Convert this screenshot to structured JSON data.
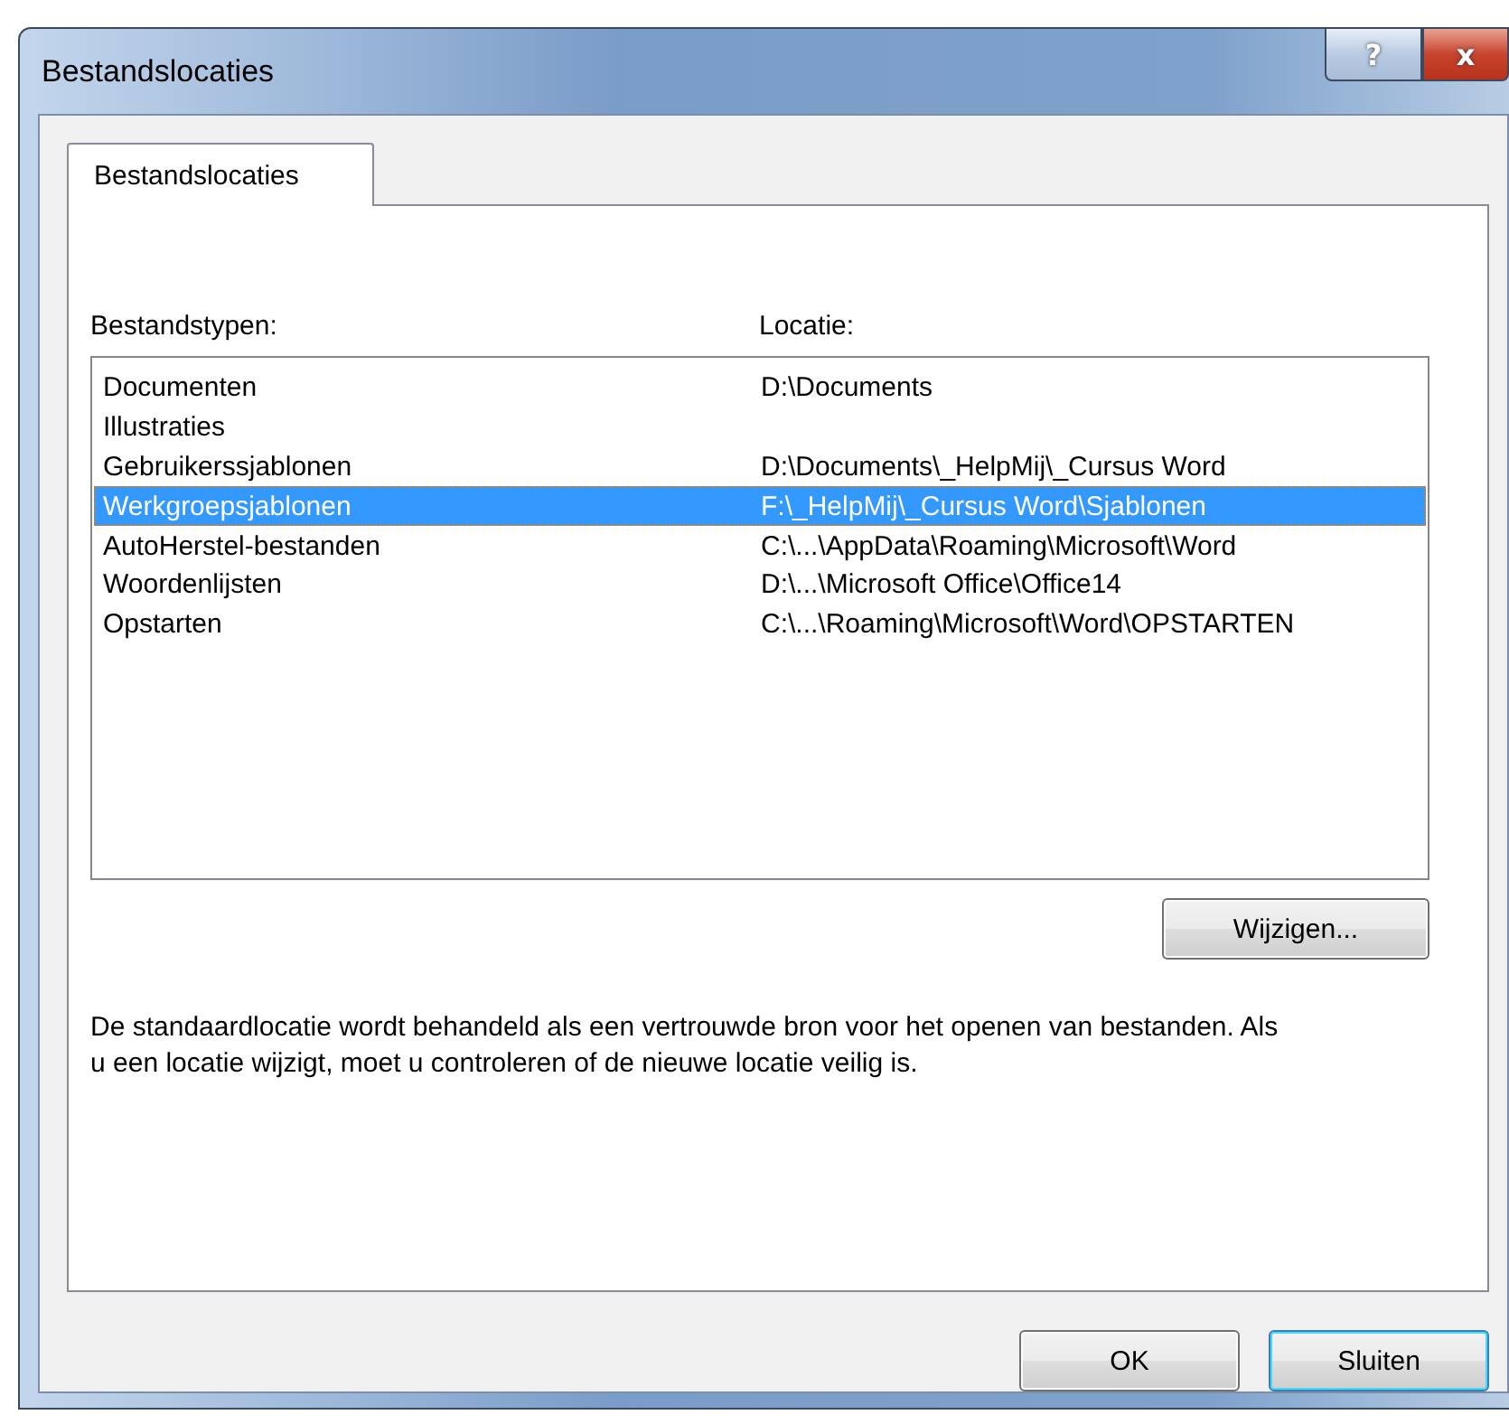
{
  "window": {
    "title": "Bestandslocaties",
    "title_buttons": [
      "?",
      "x"
    ]
  },
  "tabs": [
    {
      "label": "Bestandslocaties",
      "selected": true
    }
  ],
  "list": {
    "columns": [
      "Bestandstypen:",
      "Locatie:"
    ],
    "rows": [
      {
        "type": "Documenten",
        "location": "D:\\Documents",
        "selected": false
      },
      {
        "type": "Illustraties",
        "location": "",
        "selected": false
      },
      {
        "type": "Gebruikerssjablonen",
        "location": "D:\\Documents\\_HelpMij\\_Cursus Word",
        "selected": false
      },
      {
        "type": "Werkgroepsjablonen",
        "location": "F:\\_HelpMij\\_Cursus Word\\Sjablonen",
        "selected": true
      },
      {
        "type": "AutoHerstel-bestanden",
        "location": "C:\\...\\AppData\\Roaming\\Microsoft\\Word",
        "selected": false
      },
      {
        "type": "Woordenlijsten",
        "location": "D:\\...\\Microsoft Office\\Office14",
        "selected": false
      },
      {
        "type": "Opstarten",
        "location": "C:\\...\\Roaming\\Microsoft\\Word\\OPSTARTEN",
        "selected": false
      }
    ]
  },
  "modify_button": "Wijzigen...",
  "note": "De standaardlocatie wordt behandeld als een vertrouwde bron voor het openen van bestanden. Als u een locatie wijzigt, moet u controleren of de nieuwe locatie veilig is.",
  "buttons": [
    {
      "label": "OK",
      "default": false
    },
    {
      "label": "Sluiten",
      "default": true
    }
  ]
}
